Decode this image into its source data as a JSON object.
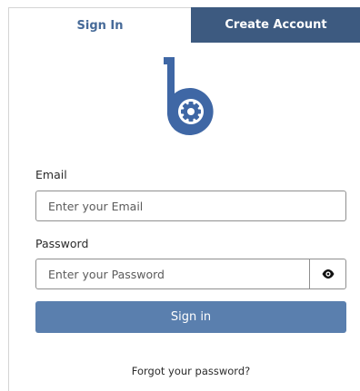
{
  "tabs": {
    "sign_in": "Sign In",
    "create_account": "Create Account",
    "active": "sign_in"
  },
  "logo": {
    "icon": "b-gear-logo",
    "color": "#3f67a5"
  },
  "form": {
    "email_label": "Email",
    "email_placeholder": "Enter your Email",
    "email_value": "",
    "password_label": "Password",
    "password_placeholder": "Enter your Password",
    "password_value": "",
    "show_password_icon": "eye-icon",
    "submit_label": "Sign in",
    "forgot_link": "Forgot your password?"
  },
  "colors": {
    "active_tab_text": "#466a98",
    "inactive_tab_bg": "#3d5a80",
    "button_bg": "#5a7fae"
  }
}
